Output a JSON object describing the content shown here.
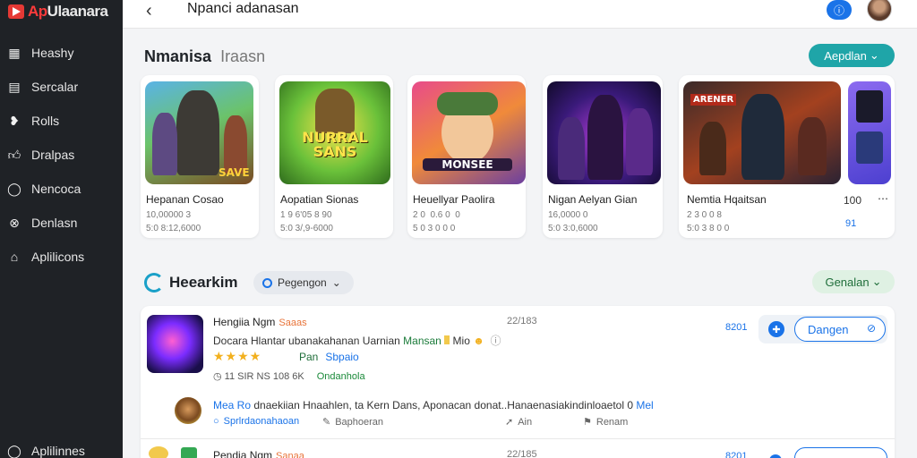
{
  "app": {
    "logo_text_red": "Ap",
    "logo_text_white": "Ulaanara"
  },
  "sidebar": {
    "items": [
      {
        "label": "Heashy",
        "icon": "grid-icon"
      },
      {
        "label": "Sercalar",
        "icon": "list-icon"
      },
      {
        "label": "Rolls",
        "icon": "heart-icon"
      },
      {
        "label": "Dralpas",
        "icon": "thumbs-up-icon"
      },
      {
        "label": "Nencoca",
        "icon": "chat-icon"
      },
      {
        "label": "Denlasn",
        "icon": "gamepad-icon"
      },
      {
        "label": "Aplilicons",
        "icon": "home-icon"
      }
    ],
    "bottom_label": "Aplilinnes"
  },
  "topbar": {
    "back": "‹",
    "title": "Npanci adanasan"
  },
  "featured": {
    "title": "Nmanisa",
    "subtitle": "Iraasn",
    "action": "Aepdlan",
    "cards": [
      {
        "name": "Hepanan Cosao",
        "meta1": "10,00000 3",
        "meta2": "5:0 8:12,6000",
        "art_text": "SAVE"
      },
      {
        "name": "Aopatian Sionas",
        "meta1": "1 9 6'05 8 90",
        "meta2": "5:0 3/,9-6000",
        "art_text": "NURRAL SANS"
      },
      {
        "name": "Heuellyar Paolira",
        "meta1": "2 0  0.6 0  0",
        "meta2": "5 0 3 0 0 0",
        "art_text": "MONSEE"
      },
      {
        "name": "Nigan Aelyan Gian",
        "meta1": "16,0000 0",
        "meta2": "5:0 3:0,6000",
        "art_text": ""
      },
      {
        "name": "Nemtia Hqaitsan",
        "meta1": "2 3 0 0 8",
        "meta2": "5:0 3 8 0 0",
        "art_text": "ARENER",
        "extra_top": "100",
        "extra_mid": "⋯",
        "extra_bot": "91"
      }
    ]
  },
  "section2": {
    "title": "Heearkim",
    "dropdown": "Pegengon",
    "action": "Genalan",
    "row1": {
      "name": "Hengiia Ngm",
      "tag": "Saaas",
      "count": "22/183",
      "desc_a": "Docara Hlantar ubanakahanan Uarnian",
      "desc_b": "Mansan",
      "desc_c": "Mio",
      "stars": "★★★★",
      "star_txt": "Pan",
      "star_txt2": "Sbpaio",
      "stats": "11 SIR NS 108 6K",
      "stats_g": "Ondanhola",
      "num": "8201",
      "button": "Dangen"
    },
    "comment": {
      "text_a": "Mea Ro",
      "text_b": "dnaekiian Hnaahlen, ta Kern Dans, Aponacan donat..Hanaenasiakindinloaetol 0",
      "text_c": "Mel",
      "meta1": "Sprlrdaonahaoan",
      "meta2": "Baphoeran",
      "meta3": "Ain",
      "meta4": "Renam"
    },
    "row2": {
      "name": "Pendia Ngm",
      "tag": "Sanaa",
      "count": "22/185",
      "num": "8201"
    }
  }
}
